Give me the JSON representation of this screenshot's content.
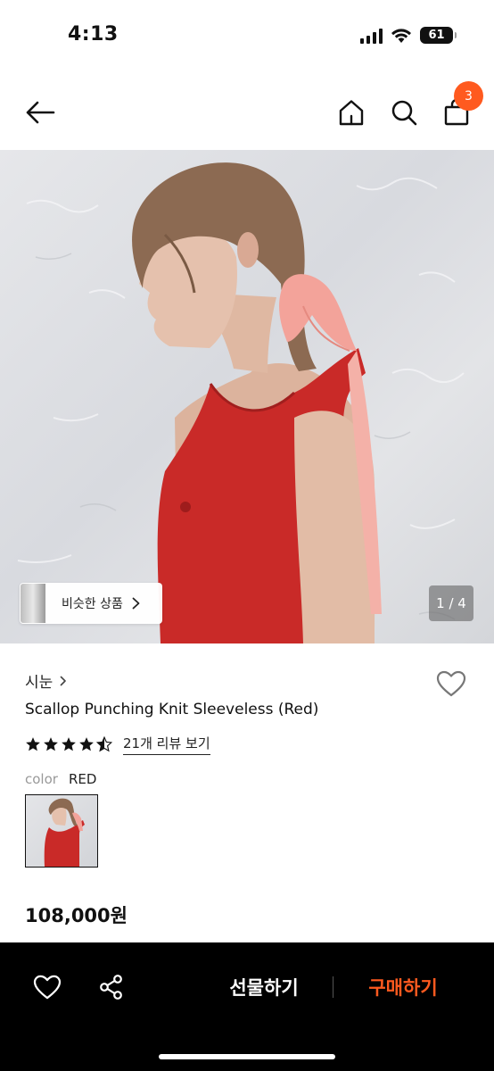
{
  "status_bar": {
    "time": "4:13",
    "battery": "61"
  },
  "header": {
    "cart_count": "3"
  },
  "product_image": {
    "similar_products_label": "비슷한 상품",
    "pager": "1 / 4"
  },
  "product": {
    "brand": "시눈",
    "name": "Scallop Punching Knit Sleeveless (Red)",
    "rating": 4.5,
    "review_link": "21개 리뷰 보기",
    "color_label": "color",
    "color_value": "RED",
    "price": "108,000원"
  },
  "bottom_bar": {
    "gift_label": "선물하기",
    "buy_label": "구매하기"
  },
  "colors": {
    "accent": "#ff5a1f",
    "bar_bg": "#000000",
    "shirt_red": "#c92a28"
  }
}
